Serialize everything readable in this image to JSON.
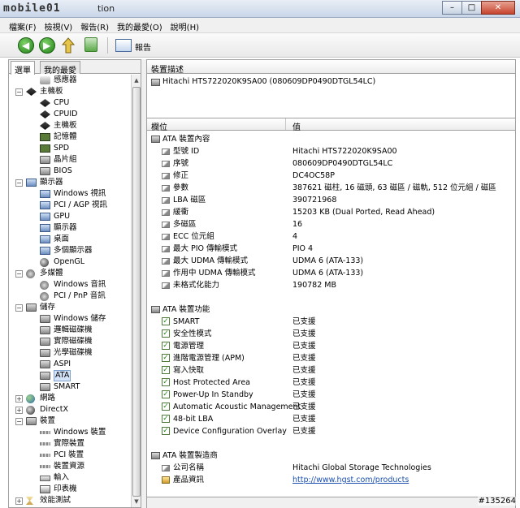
{
  "window": {
    "logo": "mobile01",
    "title": "tion",
    "controls": [
      "–",
      "□",
      "✕"
    ]
  },
  "menu": [
    "檔案(F)",
    "檢視(V)",
    "報告(R)",
    "我的最愛(O)",
    "說明(H)"
  ],
  "toolbar": {
    "report_label": "報告"
  },
  "left_tabs": [
    "選單",
    "我的最愛"
  ],
  "tree": [
    {
      "label": "感應器",
      "indent": 2,
      "icon": "sensor"
    },
    {
      "label": "主機板",
      "indent": 1,
      "icon": "board",
      "expander": "−"
    },
    {
      "label": "CPU",
      "indent": 2,
      "icon": "board"
    },
    {
      "label": "CPUID",
      "indent": 2,
      "icon": "board"
    },
    {
      "label": "主機板",
      "indent": 2,
      "icon": "board"
    },
    {
      "label": "記憶體",
      "indent": 2,
      "icon": "chip"
    },
    {
      "label": "SPD",
      "indent": 2,
      "icon": "chip"
    },
    {
      "label": "晶片組",
      "indent": 2,
      "icon": "disk"
    },
    {
      "label": "BIOS",
      "indent": 2,
      "icon": "disk"
    },
    {
      "label": "顯示器",
      "indent": 1,
      "icon": "monitor",
      "expander": "−"
    },
    {
      "label": "Windows 視訊",
      "indent": 2,
      "icon": "monitor"
    },
    {
      "label": "PCI / AGP 視訊",
      "indent": 2,
      "icon": "monitor"
    },
    {
      "label": "GPU",
      "indent": 2,
      "icon": "monitor"
    },
    {
      "label": "顯示器",
      "indent": 2,
      "icon": "monitor"
    },
    {
      "label": "桌面",
      "indent": 2,
      "icon": "monitor"
    },
    {
      "label": "多個顯示器",
      "indent": 2,
      "icon": "monitor"
    },
    {
      "label": "OpenGL",
      "indent": 2,
      "icon": "xbox"
    },
    {
      "label": "多媒體",
      "indent": 1,
      "icon": "speaker",
      "expander": "−"
    },
    {
      "label": "Windows 音訊",
      "indent": 2,
      "icon": "speaker"
    },
    {
      "label": "PCI / PnP 音訊",
      "indent": 2,
      "icon": "speaker"
    },
    {
      "label": "儲存",
      "indent": 1,
      "icon": "disk",
      "expander": "−"
    },
    {
      "label": "Windows 儲存",
      "indent": 2,
      "icon": "disk"
    },
    {
      "label": "邏輯磁碟機",
      "indent": 2,
      "icon": "disk"
    },
    {
      "label": "實際磁碟機",
      "indent": 2,
      "icon": "disk"
    },
    {
      "label": "光學磁碟機",
      "indent": 2,
      "icon": "disk"
    },
    {
      "label": "ASPI",
      "indent": 2,
      "icon": "disk"
    },
    {
      "label": "ATA",
      "indent": 2,
      "icon": "disk",
      "selected": true
    },
    {
      "label": "SMART",
      "indent": 2,
      "icon": "disk"
    },
    {
      "label": "網路",
      "indent": 1,
      "icon": "globe",
      "expander": "+"
    },
    {
      "label": "DirectX",
      "indent": 1,
      "icon": "xbox",
      "expander": "+"
    },
    {
      "label": "裝置",
      "indent": 1,
      "icon": "disk",
      "expander": "−"
    },
    {
      "label": "Windows 裝置",
      "indent": 2,
      "icon": "cable"
    },
    {
      "label": "實際裝置",
      "indent": 2,
      "icon": "cable"
    },
    {
      "label": "PCI 裝置",
      "indent": 2,
      "icon": "cable"
    },
    {
      "label": "裝置資源",
      "indent": 2,
      "icon": "cable"
    },
    {
      "label": "輸入",
      "indent": 2,
      "icon": "kb"
    },
    {
      "label": "印表機",
      "indent": 2,
      "icon": "printer"
    },
    {
      "label": "效能測試",
      "indent": 1,
      "icon": "hourglass",
      "expander": "+"
    }
  ],
  "device_desc": {
    "header": "裝置描述",
    "item": "Hitachi HTS722020K9SA00 (080609DP0490DTGL54LC)"
  },
  "grid": {
    "col_field": "欄位",
    "col_value": "值",
    "rows": [
      {
        "kind": "group",
        "name": "ATA 裝置內容",
        "icon": "disk"
      },
      {
        "kind": "item",
        "name": "型號 ID",
        "value": "Hitachi HTS722020K9SA00",
        "icon": "prop"
      },
      {
        "kind": "item",
        "name": "序號",
        "value": "080609DP0490DTGL54LC",
        "icon": "prop"
      },
      {
        "kind": "item",
        "name": "修正",
        "value": "DC4OC58P",
        "icon": "prop"
      },
      {
        "kind": "item",
        "name": "參數",
        "value": "387621 磁柱, 16 磁頭, 63 磁區 / 磁軌, 512 位元組 / 磁區",
        "icon": "prop"
      },
      {
        "kind": "item",
        "name": "LBA 磁區",
        "value": "390721968",
        "icon": "prop"
      },
      {
        "kind": "item",
        "name": "緩衝",
        "value": "15203 KB (Dual Ported, Read Ahead)",
        "icon": "prop"
      },
      {
        "kind": "item",
        "name": "多磁區",
        "value": "16",
        "icon": "prop"
      },
      {
        "kind": "item",
        "name": "ECC 位元組",
        "value": "4",
        "icon": "prop"
      },
      {
        "kind": "item",
        "name": "最大 PIO 傳輸模式",
        "value": "PIO 4",
        "icon": "prop"
      },
      {
        "kind": "item",
        "name": "最大 UDMA 傳輸模式",
        "value": "UDMA 6 (ATA-133)",
        "icon": "prop"
      },
      {
        "kind": "item",
        "name": "作用中 UDMA 傳輸模式",
        "value": "UDMA 6 (ATA-133)",
        "icon": "prop"
      },
      {
        "kind": "item",
        "name": "未格式化能力",
        "value": "190782 MB",
        "icon": "prop"
      },
      {
        "kind": "spacer"
      },
      {
        "kind": "group",
        "name": "ATA 裝置功能",
        "icon": "disk"
      },
      {
        "kind": "item",
        "name": "SMART",
        "value": "已支援",
        "icon": "check"
      },
      {
        "kind": "item",
        "name": "安全性模式",
        "value": "已支援",
        "icon": "check"
      },
      {
        "kind": "item",
        "name": "電源管理",
        "value": "已支援",
        "icon": "check"
      },
      {
        "kind": "item",
        "name": "進階電源管理 (APM)",
        "value": "已支援",
        "icon": "check"
      },
      {
        "kind": "item",
        "name": "寫入快取",
        "value": "已支援",
        "icon": "check"
      },
      {
        "kind": "item",
        "name": "Host Protected Area",
        "value": "已支援",
        "icon": "check"
      },
      {
        "kind": "item",
        "name": "Power-Up In Standby",
        "value": "已支援",
        "icon": "check"
      },
      {
        "kind": "item",
        "name": "Automatic Acoustic Management",
        "value": "已支援",
        "icon": "check"
      },
      {
        "kind": "item",
        "name": "48-bit LBA",
        "value": "已支援",
        "icon": "check"
      },
      {
        "kind": "item",
        "name": "Device Configuration Overlay",
        "value": "已支援",
        "icon": "check"
      },
      {
        "kind": "spacer"
      },
      {
        "kind": "group",
        "name": "ATA 裝置製造商",
        "icon": "disk"
      },
      {
        "kind": "item",
        "name": "公司名稱",
        "value": "Hitachi Global Storage Technologies",
        "icon": "prop"
      },
      {
        "kind": "item",
        "name": "產品資訊",
        "value": "http://www.hgst.com/products",
        "icon": "link",
        "link": true
      }
    ]
  },
  "watermark": "#135264"
}
